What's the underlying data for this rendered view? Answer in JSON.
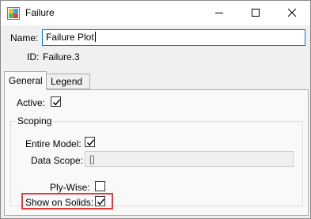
{
  "window": {
    "title": "Failure",
    "app_icon": "colorful-app-icon",
    "controls": {
      "minimize": "minimize-icon",
      "maximize": "maximize-icon",
      "close": "close-icon"
    }
  },
  "form": {
    "name_label": "Name:",
    "name_value": "Failure Plot",
    "id_label": "ID:",
    "id_value": "Failure.3"
  },
  "tabs": [
    {
      "label": "General",
      "selected": true
    },
    {
      "label": "Legend",
      "selected": false
    }
  ],
  "general": {
    "active_label": "Active:",
    "active_checked": true,
    "scoping_group_label": "Scoping",
    "entire_model_label": "Entire Model:",
    "entire_model_checked": true,
    "data_scope_label": "Data Scope:",
    "data_scope_value": "[]",
    "ply_wise_label": "Ply-Wise:",
    "ply_wise_checked": false,
    "show_on_solids_label": "Show on Solids:",
    "show_on_solids_checked": true
  },
  "colors": {
    "highlight_border": "#e03c3c",
    "input_focus_border": "#0078d7"
  }
}
